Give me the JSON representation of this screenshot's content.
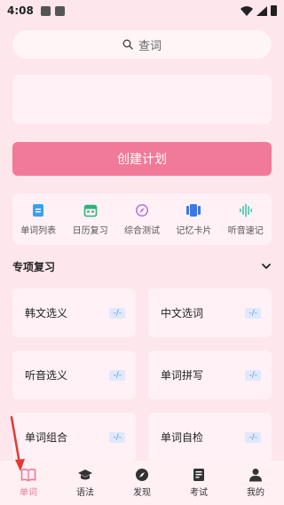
{
  "status_bar": {
    "time": "4:08"
  },
  "search": {
    "placeholder_label": "查词"
  },
  "plan": {
    "create_label": "创建计划"
  },
  "tools": [
    {
      "label": "单词列表",
      "icon": "document-icon",
      "color": "#3aa0ee"
    },
    {
      "label": "日历复习",
      "icon": "calendar-icon",
      "color": "#2fb37d"
    },
    {
      "label": "综合测试",
      "icon": "compass-icon",
      "color": "#b47ae0"
    },
    {
      "label": "记忆卡片",
      "icon": "cards-icon",
      "color": "#3a78e8"
    },
    {
      "label": "听音速记",
      "icon": "waveform-icon",
      "color": "#3ac9b0"
    }
  ],
  "section": {
    "title": "专项复习"
  },
  "reviews": [
    {
      "label": "韩文选义",
      "badge": "-/-"
    },
    {
      "label": "中文选词",
      "badge": "-/-"
    },
    {
      "label": "听音选义",
      "badge": "-/-"
    },
    {
      "label": "单词拼写",
      "badge": "-/-"
    },
    {
      "label": "单词组合",
      "badge": "-/-"
    },
    {
      "label": "单词自检",
      "badge": "-/-"
    }
  ],
  "tabs": [
    {
      "label": "单词",
      "icon": "book-icon",
      "active": true
    },
    {
      "label": "语法",
      "icon": "graduation-cap-icon",
      "active": false
    },
    {
      "label": "发现",
      "icon": "compass-icon",
      "active": false
    },
    {
      "label": "考试",
      "icon": "exam-paper-icon",
      "active": false
    },
    {
      "label": "我的",
      "icon": "person-icon",
      "active": false
    }
  ],
  "colors": {
    "accent": "#f07a98",
    "background": "#fde6ec",
    "annotation_arrow": "#e53935"
  }
}
